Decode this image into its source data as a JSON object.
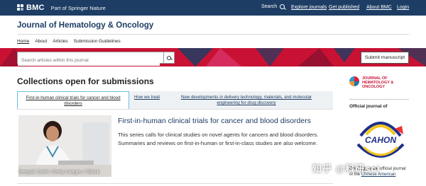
{
  "topbar": {
    "brand": "BMC",
    "tagline": "Part of Springer Nature",
    "search_label": "Search",
    "nav": [
      "Explore journals",
      "Get published",
      "About BMC",
      "Login"
    ]
  },
  "journal": {
    "title": "Journal of Hematology & Oncology",
    "subnav": [
      "Home",
      "About",
      "Articles",
      "Submission Guidelines"
    ]
  },
  "banner": {
    "search_placeholder": "Search articles within this journal",
    "submit_label": "Submit manuscript"
  },
  "collections": {
    "heading": "Collections open for submissions",
    "tabs": [
      "First-in-human clinical trials for cancer and blood disorders",
      "How we treat",
      "New developments in delivery technology, materials, and molecular engineering for drug discovery"
    ],
    "card_title": "First-in-human clinical trials for cancer and blood disorders",
    "card_desc": "This series calls for clinical studies on novel agents for cancers and blood disorders. Summaries and reviews on first-in-human or first-in-class studies are also welcome.",
    "image_credit": "Deepak Sethi / Getty Images / iStock."
  },
  "sidebar": {
    "logo_text": "JOURNAL OF HEMATOLOGY & ONCOLOGY",
    "official_label": "Official journal of",
    "cahon_text": "CAHON",
    "desc_prefix": "Oncology is the official journal of the",
    "desc_link": "Chinese American"
  },
  "watermark": "知乎 @科研sci",
  "colors": {
    "navy": "#1d3d64",
    "brand_red": "#c81133",
    "tab_border": "#6cc0e0"
  }
}
